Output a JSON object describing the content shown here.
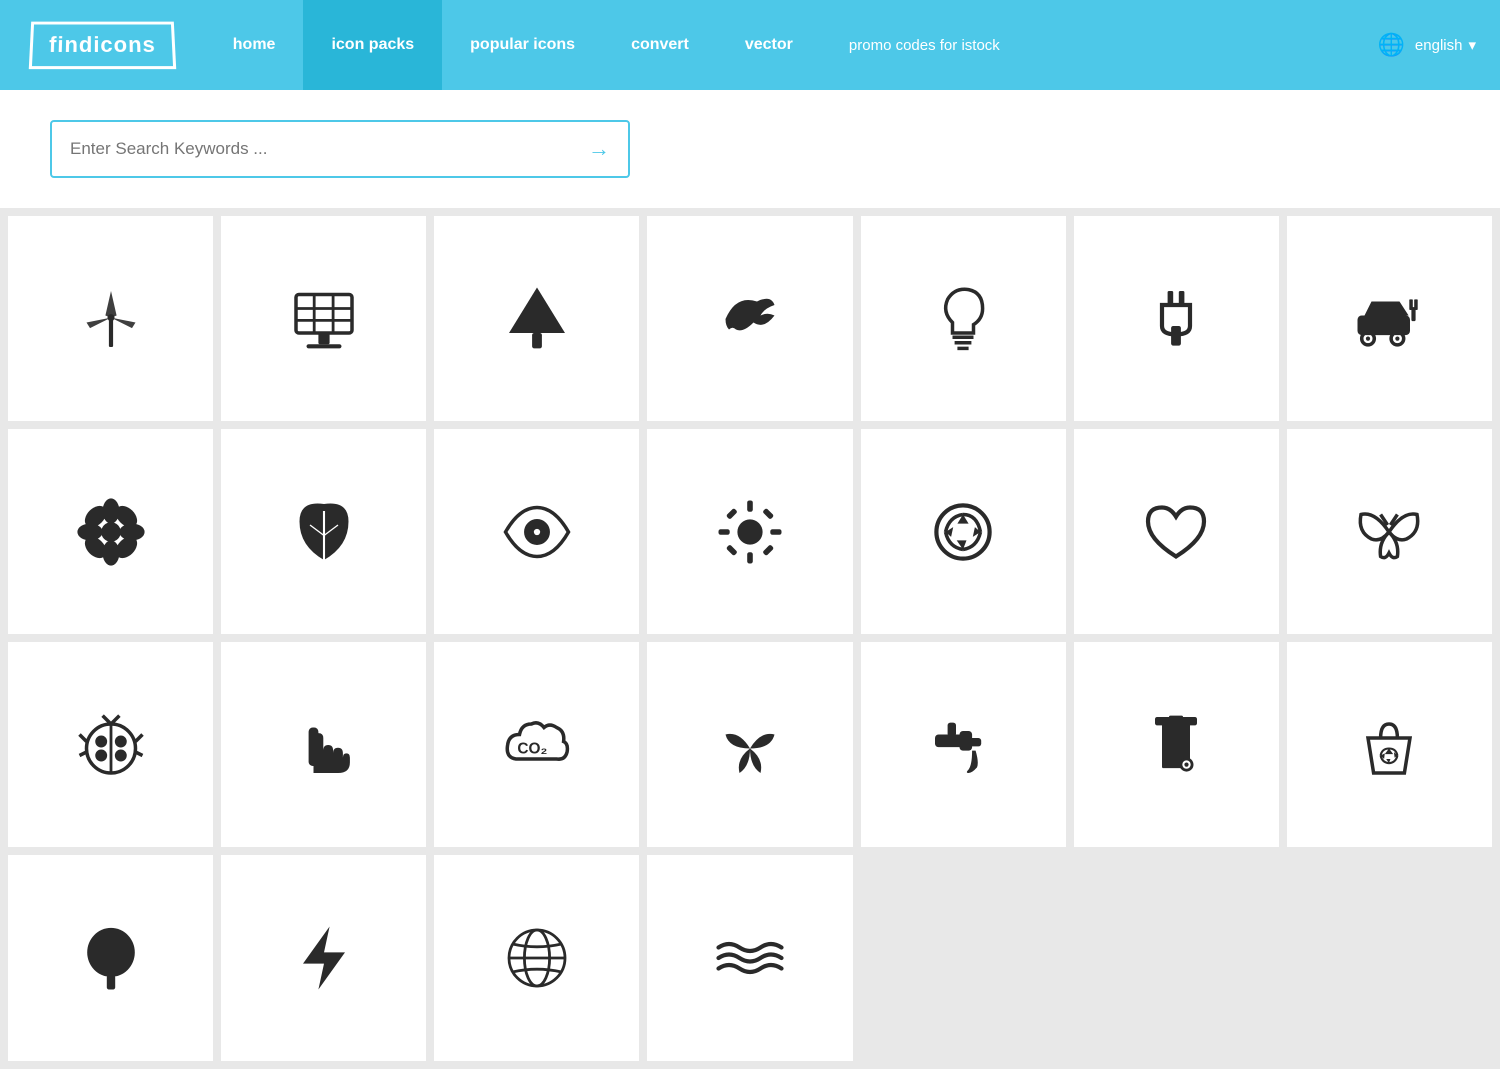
{
  "nav": {
    "logo": "findicons",
    "items": [
      {
        "label": "home",
        "active": false
      },
      {
        "label": "icon packs",
        "active": true
      },
      {
        "label": "popular icons",
        "active": false
      },
      {
        "label": "convert",
        "active": false
      },
      {
        "label": "vector",
        "active": false
      }
    ],
    "promo": "promo codes for istock",
    "lang": "english"
  },
  "search": {
    "placeholder": "Enter Search Keywords ..."
  },
  "icons": [
    "wind-turbine",
    "solar-panel",
    "tree",
    "bird",
    "lightbulb",
    "plug",
    "electric-car",
    "flower",
    "leaf",
    "eye",
    "sun",
    "recycle",
    "heart",
    "butterfly",
    "ladybug",
    "hand",
    "co2-cloud",
    "plant",
    "faucet",
    "trash-bin",
    "recycle-bag",
    "tree-round",
    "lightning",
    "globe",
    "waves",
    "empty",
    "empty",
    "empty"
  ]
}
